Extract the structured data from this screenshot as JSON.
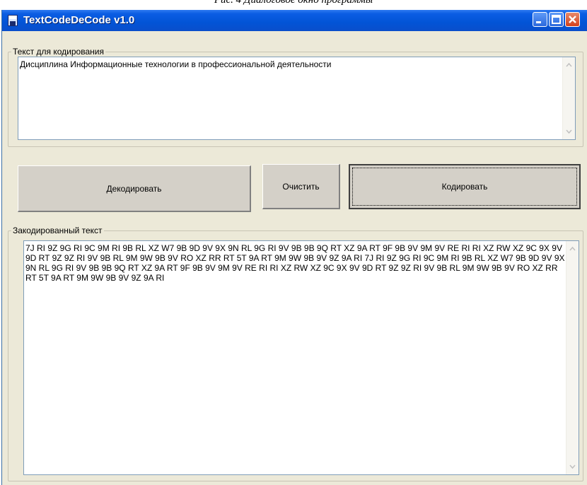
{
  "caption": "Рис. 4 Диалоговое окно программы",
  "window": {
    "title": "TextCodeDeCode v1.0",
    "titlebar_color": "#0a4ecb"
  },
  "input_group": {
    "legend": "Текст для кодирования",
    "text": "Дисциплина Информационные технологии в профессиональной деятельности"
  },
  "buttons": {
    "decode": "Декодировать",
    "clear": "Очистить",
    "encode": "Кодировать"
  },
  "output_group": {
    "legend": "Закодированный текст",
    "text": "7J RI 9Z 9G RI 9C 9M RI 9B RL XZ W7 9B 9D 9V 9X 9N RL 9G RI 9V 9B 9B 9Q RT XZ 9A RT 9F 9B 9V 9M 9V RE RI RI XZ RW XZ 9C 9X 9V 9D RT 9Z 9Z RI 9V 9B RL 9M 9W 9B 9V RO XZ RR RT 5T 9A RT 9M 9W 9B 9V 9Z 9A RI 7J RI 9Z 9G RI 9C 9M RI 9B RL XZ W7 9B 9D 9V 9X 9N RL 9G RI 9V 9B 9B 9Q RT XZ 9A RT 9F 9B 9V 9M 9V RE RI RI XZ RW XZ 9C 9X 9V 9D RT 9Z 9Z RI 9V 9B RL 9M 9W 9B 9V RO XZ RR RT 5T 9A RT 9M 9W 9B 9V 9Z 9A RI"
  }
}
